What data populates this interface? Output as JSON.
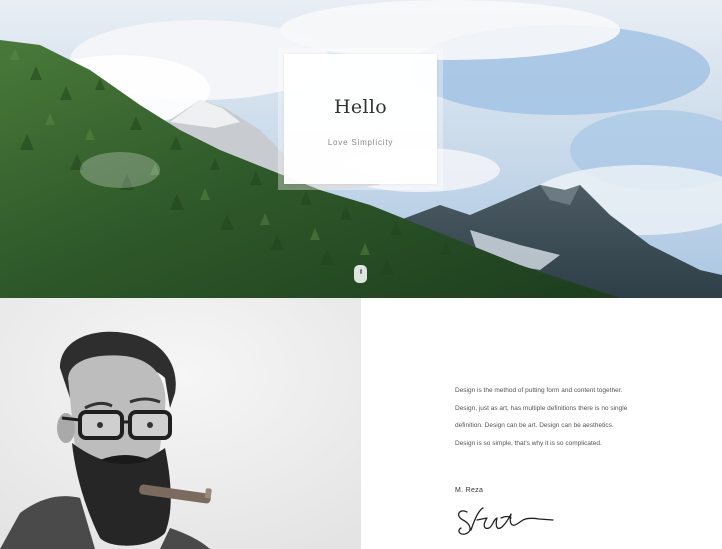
{
  "hero": {
    "title": "Hello",
    "subtitle": "Love Simplicity"
  },
  "about": {
    "paragraph": "Design is the method of putting form and content together. Design, just as art, has multiple definitions there is no single definition. Design can be art. Design can be aesthetics. Design is so simple, that's why it is so complicated.",
    "author": "M. Reza"
  },
  "colors": {
    "sky": "#d9e6f2",
    "forest": "#2f5a2a",
    "panel_gray": "#efefef",
    "text": "#555555"
  },
  "icons": {
    "scroll": "scroll-down-icon",
    "signature": "signature-icon"
  }
}
